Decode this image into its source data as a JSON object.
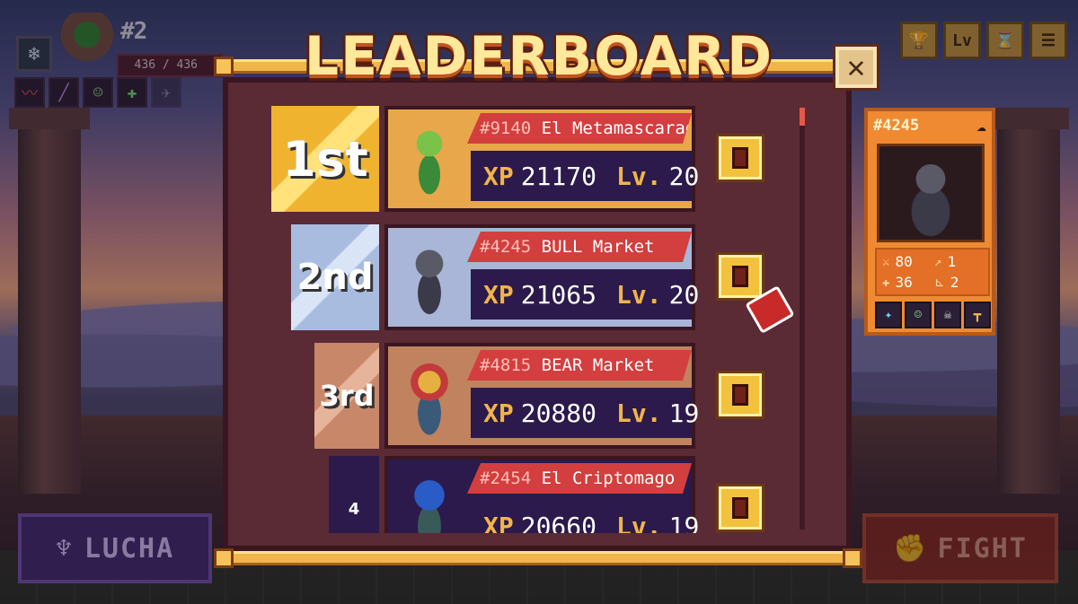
{
  "hud": {
    "rank": "#2",
    "hp": "436 / 436",
    "slots": [
      "chart-icon",
      "staff-icon",
      "mask-icon",
      "gear-icon",
      "blade-icon"
    ]
  },
  "top_icons": [
    {
      "name": "trophy-icon",
      "glyph": "🏆"
    },
    {
      "name": "level-icon",
      "glyph": "Lv"
    },
    {
      "name": "hourglass-icon",
      "glyph": "⌛"
    },
    {
      "name": "menu-icon",
      "glyph": "☰"
    }
  ],
  "modal": {
    "title": "LEADERBOARD"
  },
  "leaderboard": [
    {
      "rank": "1st",
      "id": "#9140",
      "name": "El Metamascarad",
      "xp_label": "XP",
      "xp": "21170",
      "lv_label": "Lv.",
      "lv": "20",
      "rank_bg": "#f0b330",
      "card_bg": "#e8a74a"
    },
    {
      "rank": "2nd",
      "id": "#4245",
      "name": "BULL Market",
      "xp_label": "XP",
      "xp": "21065",
      "lv_label": "Lv.",
      "lv": "20",
      "rank_bg": "#a8bce0",
      "card_bg": "#a9b6d8"
    },
    {
      "rank": "3rd",
      "id": "#4815",
      "name": "BEAR Market",
      "xp_label": "XP",
      "xp": "20880",
      "lv_label": "Lv.",
      "lv": "19",
      "rank_bg": "#c9876a",
      "card_bg": "#c0825f"
    },
    {
      "rank": "4",
      "id": "#2454",
      "name": "El Criptomago",
      "xp_label": "XP",
      "xp": "20660",
      "lv_label": "Lv.",
      "lv": "19",
      "rank_bg": "#2b1a4b",
      "card_bg": "#2b1a4b"
    }
  ],
  "profile": {
    "id": "#4245",
    "stats": [
      {
        "icon": "sword-icon",
        "glyph": "⚔",
        "value": "80"
      },
      {
        "icon": "boost-icon",
        "glyph": "↗",
        "value": "1"
      },
      {
        "icon": "health-icon",
        "glyph": "✚",
        "value": "36"
      },
      {
        "icon": "speed-icon",
        "glyph": "⊾",
        "value": "2"
      }
    ]
  },
  "buttons": {
    "lucha": "LUCHA",
    "fight": "FIGHT"
  }
}
